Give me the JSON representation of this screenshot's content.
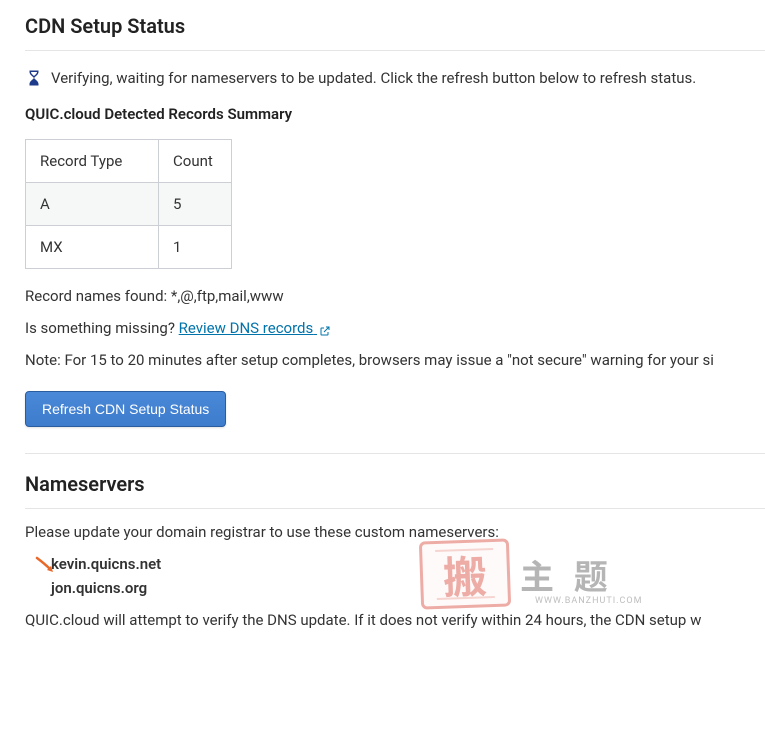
{
  "cdn_status": {
    "heading": "CDN Setup Status",
    "verify_msg": "Verifying, waiting for nameservers to be updated. Click the refresh button below to refresh status.",
    "records_summary_heading": "QUIC.cloud Detected Records Summary",
    "table": {
      "headers": {
        "type": "Record Type",
        "count": "Count"
      },
      "rows": [
        {
          "type": "A",
          "count": "5"
        },
        {
          "type": "MX",
          "count": "1"
        }
      ]
    },
    "record_names_label": "Record names found:",
    "record_names_value": "*,@,ftp,mail,www",
    "missing_prompt": "Is something missing?",
    "review_link_text": "Review DNS records",
    "note_text": "Note: For 15 to 20 minutes after setup completes, browsers may issue a \"not secure\" warning for your si",
    "refresh_button": "Refresh CDN Setup Status"
  },
  "nameservers": {
    "heading": "Nameservers",
    "instruction": "Please update your domain registrar to use these custom nameservers:",
    "servers": [
      "kevin.quicns.net",
      "jon.quicns.org"
    ],
    "followup": "QUIC.cloud will attempt to verify the DNS update. If it does not verify within 24 hours, the CDN setup w"
  },
  "watermark": {
    "stamp": "搬",
    "text": "主 题",
    "url": "WWW.BANZHUTI.COM"
  }
}
